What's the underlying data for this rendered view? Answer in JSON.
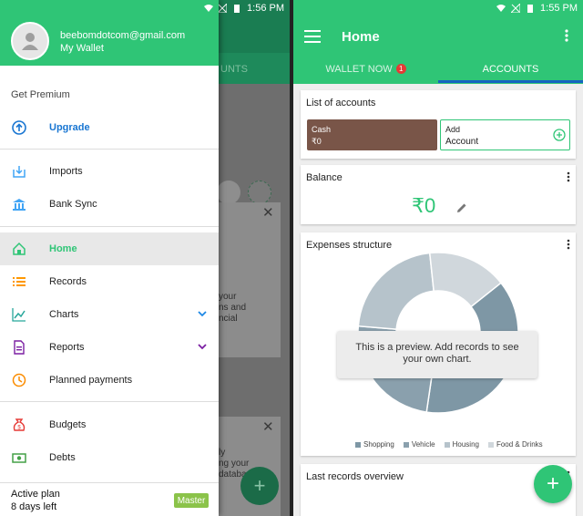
{
  "left_screen": {
    "status_time": "1:56 PM",
    "behind": {
      "tab_fragment": "UNTS",
      "text_fragment_1": "your\nns and\nncial",
      "text_fragment_2": "ly\nng your\ndataba"
    },
    "drawer": {
      "email": "beebomdotcom@gmail.com",
      "wallet": "My Wallet",
      "section_premium": "Get Premium",
      "upgrade": "Upgrade",
      "items": [
        {
          "label": "Imports",
          "icon": "import-icon"
        },
        {
          "label": "Bank Sync",
          "icon": "bank-icon"
        },
        {
          "label": "Home",
          "icon": "home-icon"
        },
        {
          "label": "Records",
          "icon": "list-icon"
        },
        {
          "label": "Charts",
          "icon": "chart-icon"
        },
        {
          "label": "Reports",
          "icon": "report-icon"
        },
        {
          "label": "Planned payments",
          "icon": "schedule-icon"
        },
        {
          "label": "Budgets",
          "icon": "money-bag-icon"
        },
        {
          "label": "Debts",
          "icon": "cash-icon"
        }
      ],
      "plan_title": "Active plan",
      "plan_days": "8 days left",
      "plan_badge": "Master"
    }
  },
  "right_screen": {
    "status_time": "1:55 PM",
    "title": "Home",
    "tabs": [
      {
        "label": "WALLET NOW",
        "badge": "1"
      },
      {
        "label": "ACCOUNTS"
      }
    ],
    "accounts_card": {
      "title": "List of accounts",
      "cash_label": "Cash",
      "cash_value": "₹0",
      "add_label": "Add",
      "add_sub": "Account"
    },
    "balance_card": {
      "title": "Balance",
      "value": "₹0"
    },
    "expenses_card": {
      "title": "Expenses structure",
      "preview_text": "This is a preview. Add records to see your own chart.",
      "legend": [
        {
          "label": "Shopping",
          "color": "#7e97a5"
        },
        {
          "label": "Vehicle",
          "color": "#8aa0ad"
        },
        {
          "label": "Housing",
          "color": "#b6c3cb"
        },
        {
          "label": "Food & Drinks",
          "color": "#d0d7dc"
        }
      ]
    },
    "last_records_card": {
      "title": "Last records overview"
    }
  },
  "colors": {
    "brand_green": "#2fc576",
    "cash_brown": "#795548",
    "tab_indicator": "#1565c0",
    "badge_red": "#e53935",
    "master_green": "#8bc34a"
  },
  "chart_data": {
    "type": "pie",
    "variant": "donut",
    "categories": [
      "Shopping",
      "Vehicle",
      "Housing",
      "Food & Drinks"
    ],
    "values": [
      38,
      24,
      22,
      16
    ]
  }
}
